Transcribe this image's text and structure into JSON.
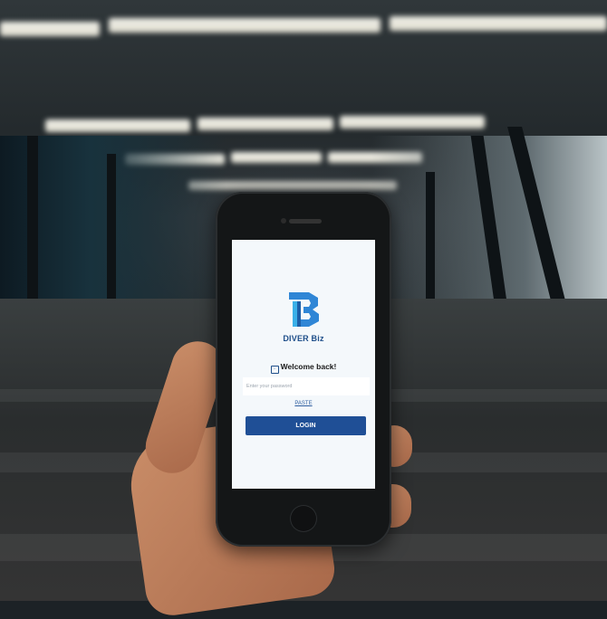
{
  "app": {
    "brand_name": "DIVER Biz",
    "logo_icon": "diver-biz-logo-icon",
    "welcome_text": "Welcome back!",
    "welcome_icon": "badge-icon"
  },
  "form": {
    "password_placeholder": "Enter your password",
    "password_value": "",
    "paste_label": "PASTE",
    "login_label": "LOGIN"
  },
  "colors": {
    "brand_blue": "#1f4f96",
    "screen_bg": "#f4f8fb"
  }
}
